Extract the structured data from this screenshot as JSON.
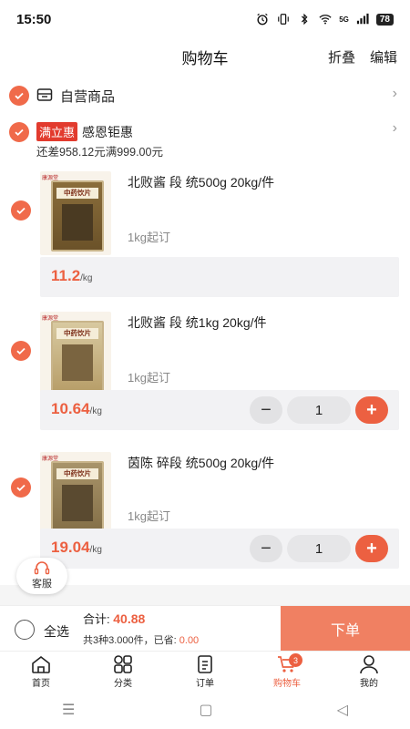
{
  "status_bar": {
    "time": "15:50",
    "network": "5G",
    "battery": "78"
  },
  "nav": {
    "title": "购物车",
    "collapse_label": "折叠",
    "edit_label": "编辑"
  },
  "store": {
    "name": "自营商品"
  },
  "promo": {
    "tag": "满立惠",
    "name": "感恩钜惠",
    "subtitle": "还差958.12元满999.00元"
  },
  "products": [
    {
      "name": "北败酱 段 统500g 20kg/件",
      "moq": "1kg起订",
      "price": "11.2",
      "unit": "/kg",
      "image_brand": "康源堂",
      "image_label": "中药饮片",
      "has_stepper": false
    },
    {
      "name": "北败酱 段 统1kg 20kg/件",
      "moq": "1kg起订",
      "price": "10.64",
      "unit": "/kg",
      "image_brand": "康源堂",
      "image_label": "中药饮片",
      "has_stepper": true,
      "qty": "1"
    },
    {
      "name": "茵陈 碎段 统500g 20kg/件",
      "moq": "1kg起订",
      "price": "19.04",
      "unit": "/kg",
      "image_brand": "康源堂",
      "image_label": "中药饮片",
      "has_stepper": true,
      "qty": "1"
    }
  ],
  "service": {
    "label": "客服"
  },
  "checkout": {
    "select_all_label": "全选",
    "total_label": "合计:",
    "total_value": "40.88",
    "summary_prefix": "共3种3.000件，已省:",
    "saved_value": "0.00",
    "order_button": "下单"
  },
  "tabs": [
    {
      "label": "首页",
      "icon": "home-icon"
    },
    {
      "label": "分类",
      "icon": "category-icon"
    },
    {
      "label": "订单",
      "icon": "order-icon"
    },
    {
      "label": "购物车",
      "icon": "cart-icon",
      "badge": "3",
      "active": true
    },
    {
      "label": "我的",
      "icon": "profile-icon"
    }
  ],
  "colors": {
    "accent": "#ec6041",
    "promo_tag": "#e23b2e",
    "order_button": "#f08062"
  }
}
